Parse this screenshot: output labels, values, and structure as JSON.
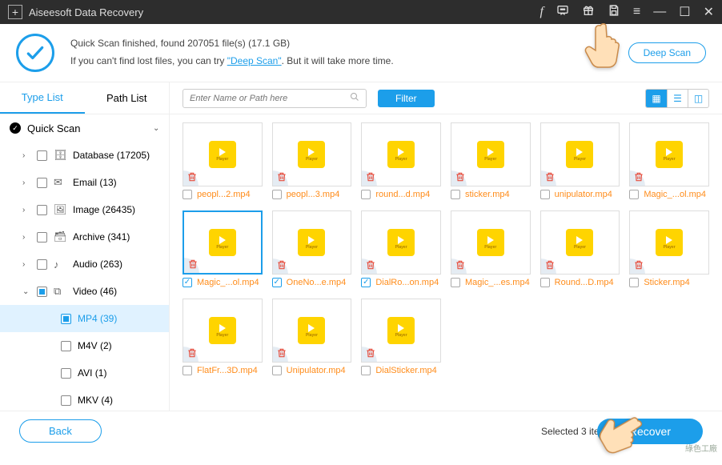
{
  "title": "Aiseesoft Data Recovery",
  "banner": {
    "line1": "Quick Scan finished, found 207051 file(s) (17.1 GB)",
    "line2_pre": "If you can't find lost files, you can try ",
    "line2_link": "\"Deep Scan\"",
    "line2_post": ". But it will take more time.",
    "deep_scan": "Deep Scan"
  },
  "tabs": {
    "type": "Type List",
    "path": "Path List"
  },
  "root_label": "Quick Scan",
  "tree": [
    {
      "icon": "🗄",
      "label": "Database (17205)",
      "indent": 1
    },
    {
      "icon": "✉",
      "label": "Email (13)",
      "indent": 1
    },
    {
      "icon": "🖼",
      "label": "Image (26435)",
      "indent": 1
    },
    {
      "icon": "🗃",
      "label": "Archive (341)",
      "indent": 1
    },
    {
      "icon": "♪",
      "label": "Audio (263)",
      "indent": 1
    },
    {
      "icon": "⧉",
      "label": "Video (46)",
      "indent": 1,
      "open": true,
      "partial": true
    }
  ],
  "children": [
    {
      "label": "MP4 (39)",
      "selected": true,
      "partial": true
    },
    {
      "label": "M4V (2)"
    },
    {
      "label": "AVI (1)"
    },
    {
      "label": "MKV (4)"
    }
  ],
  "search_placeholder": "Enter Name or Path here",
  "filter": "Filter",
  "files": [
    {
      "name": "peopl...2.mp4"
    },
    {
      "name": "peopl...3.mp4"
    },
    {
      "name": "round...d.mp4"
    },
    {
      "name": "sticker.mp4"
    },
    {
      "name": "unipulator.mp4"
    },
    {
      "name": "Magic_...ol.mp4"
    },
    {
      "name": "Magic_...ol.mp4",
      "checked": true,
      "sel": true
    },
    {
      "name": "OneNo...e.mp4",
      "checked": true
    },
    {
      "name": "DialRo...on.mp4",
      "checked": true
    },
    {
      "name": "Magic_...es.mp4"
    },
    {
      "name": "Round...D.mp4"
    },
    {
      "name": "Sticker.mp4"
    },
    {
      "name": "FlatFr...3D.mp4"
    },
    {
      "name": "Unipulator.mp4"
    },
    {
      "name": "DialSticker.mp4"
    }
  ],
  "selected_text": "Selected 3 items/",
  "back": "Back",
  "recover": "Recover",
  "watermark": "綠色工廠"
}
